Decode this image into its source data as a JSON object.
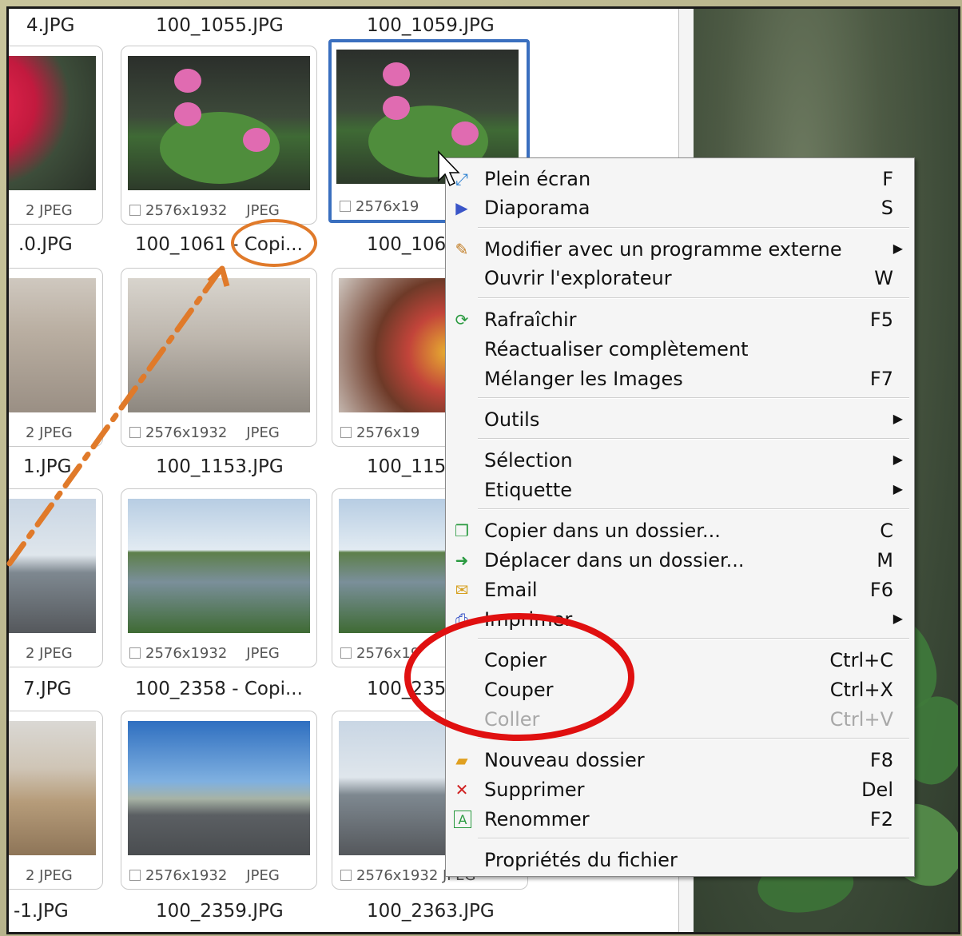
{
  "grid": {
    "filenames": {
      "r0": [
        "4.JPG",
        "100_1055.JPG",
        "100_1059.JPG"
      ],
      "r1": [
        ".0.JPG",
        "100_1061 - Copi...",
        "100_106"
      ],
      "r2": [
        "1.JPG",
        "100_1153.JPG",
        "100_115"
      ],
      "r3": [
        "7.JPG",
        "100_2358 - Copi...",
        "100_235"
      ],
      "r4": [
        "-1.JPG",
        "100_2359.JPG",
        "100_2363.JPG"
      ]
    },
    "meta": {
      "partial_left": "2 JPEG",
      "full": "2576x1932",
      "format": "JPEG",
      "clipped": "2576x19",
      "last_right": "2576x1932 JPEG"
    }
  },
  "menu": {
    "items": [
      {
        "label": "Plein écran",
        "shortcut": "F",
        "icon": "fullscreen-icon"
      },
      {
        "label": "Diaporama",
        "shortcut": "S",
        "icon": "slideshow-icon"
      },
      {
        "label": "Modifier avec un programme externe",
        "shortcut": "",
        "icon": "palette-icon",
        "submenu": true
      },
      {
        "label": "Ouvrir l'explorateur",
        "shortcut": "W"
      },
      {
        "label": "Rafraîchir",
        "shortcut": "F5",
        "icon": "refresh-icon"
      },
      {
        "label": "Réactualiser complètement",
        "shortcut": ""
      },
      {
        "label": "Mélanger les Images",
        "shortcut": "F7"
      },
      {
        "label": "Outils",
        "shortcut": "",
        "submenu": true
      },
      {
        "label": "Sélection",
        "shortcut": "",
        "submenu": true
      },
      {
        "label": "Etiquette",
        "shortcut": "",
        "submenu": true
      },
      {
        "label": "Copier dans un dossier...",
        "shortcut": "C",
        "icon": "copy-to-folder-icon"
      },
      {
        "label": "Déplacer dans un dossier...",
        "shortcut": "M",
        "icon": "move-to-folder-icon"
      },
      {
        "label": "Email",
        "shortcut": "F6",
        "icon": "email-icon"
      },
      {
        "label": "Imprimer",
        "shortcut": "",
        "icon": "printer-icon",
        "submenu": true
      },
      {
        "label": "Copier",
        "shortcut": "Ctrl+C"
      },
      {
        "label": "Couper",
        "shortcut": "Ctrl+X"
      },
      {
        "label": "Coller",
        "shortcut": "Ctrl+V",
        "disabled": true
      },
      {
        "label": "Nouveau dossier",
        "shortcut": "F8",
        "icon": "new-folder-icon"
      },
      {
        "label": "Supprimer",
        "shortcut": "Del",
        "icon": "delete-icon"
      },
      {
        "label": "Renommer",
        "shortcut": "F2",
        "icon": "rename-icon"
      },
      {
        "label": "Propriétés du fichier",
        "shortcut": ""
      }
    ]
  },
  "colors": {
    "selection_border": "#3a6fbf",
    "annotation_orange": "#e07a2a",
    "annotation_red": "#e01010"
  }
}
